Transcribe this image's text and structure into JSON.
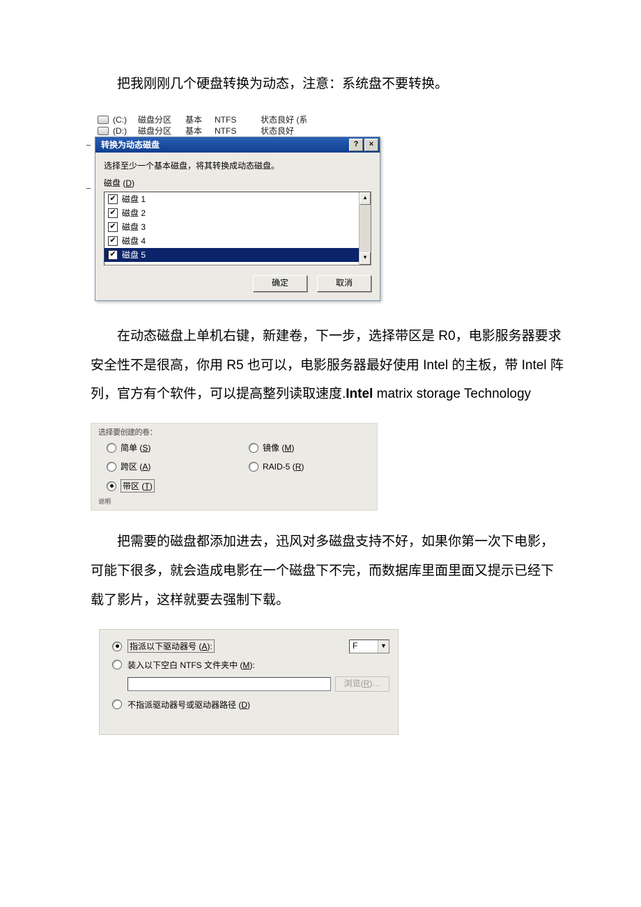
{
  "para1": "把我刚刚几个硬盘转换为动态，注意：系统盘不要转换。",
  "shot1": {
    "bg_rows": [
      {
        "drive": "(C:)",
        "c2": "磁盘分区",
        "c3": "基本",
        "c4": "NTFS",
        "c5": "状态良好 (系"
      },
      {
        "drive": "(D:)",
        "c2": "磁盘分区",
        "c3": "基本",
        "c4": "NTFS",
        "c5": "状态良好"
      }
    ],
    "title": "转换为动态磁盘",
    "help": "?",
    "close": "×",
    "instruction": "选择至少一个基本磁盘，将其转换成动态磁盘。",
    "list_label_pre": "磁盘 (",
    "list_label_letter": "D",
    "list_label_post": ")",
    "items": [
      {
        "label": "磁盘 1",
        "checked": true,
        "selected": false
      },
      {
        "label": "磁盘 2",
        "checked": true,
        "selected": false
      },
      {
        "label": "磁盘 3",
        "checked": true,
        "selected": false
      },
      {
        "label": "磁盘 4",
        "checked": true,
        "selected": false
      },
      {
        "label": "磁盘 5",
        "checked": true,
        "selected": true
      }
    ],
    "scroll_up": "▴",
    "scroll_down": "▾",
    "ok": "确定",
    "cancel": "取消"
  },
  "para2_a": "在动态磁盘上单机右键，新建卷，下一步，选择带区是 R0，电影服务器要求安全性不是很高，你用 R5 也可以，电影服务器最好使用 Intel 的主板，带 Intel 阵列，官方有个软件，可以提高整列读取速度.",
  "para2_b": "Intel",
  "para2_c": " matrix storage Technology",
  "shot2": {
    "header": "选择要创建的卷：",
    "options": [
      {
        "label": "简单",
        "letter": "S",
        "checked": false
      },
      {
        "label": "镜像",
        "letter": "M",
        "checked": false
      },
      {
        "label": "跨区",
        "letter": "A",
        "checked": false
      },
      {
        "label": "RAID-5",
        "letter": "R",
        "checked": false
      },
      {
        "label": "带区",
        "letter": "T",
        "checked": true
      }
    ],
    "footer": "说明"
  },
  "para3": "把需要的磁盘都添加进去，迅风对多磁盘支持不好，如果你第一次下电影，可能下很多，就会造成电影在一个磁盘下不完，而数据库里面里面又提示已经下载了影片，这样就要去强制下载。",
  "shot3": {
    "opt1": {
      "label": "指派以下驱动器号",
      "letter": "A",
      "checked": true,
      "dotted": true
    },
    "drive_value": "F",
    "drive_arrow": "▼",
    "opt2": {
      "label": "装入以下空白 NTFS 文件夹中",
      "letter": "M",
      "checked": false
    },
    "browse_pre": "浏览(",
    "browse_letter": "R",
    "browse_post": ")…",
    "opt3": {
      "label": "不指派驱动器号或驱动器路径",
      "letter": "D",
      "checked": false
    }
  }
}
